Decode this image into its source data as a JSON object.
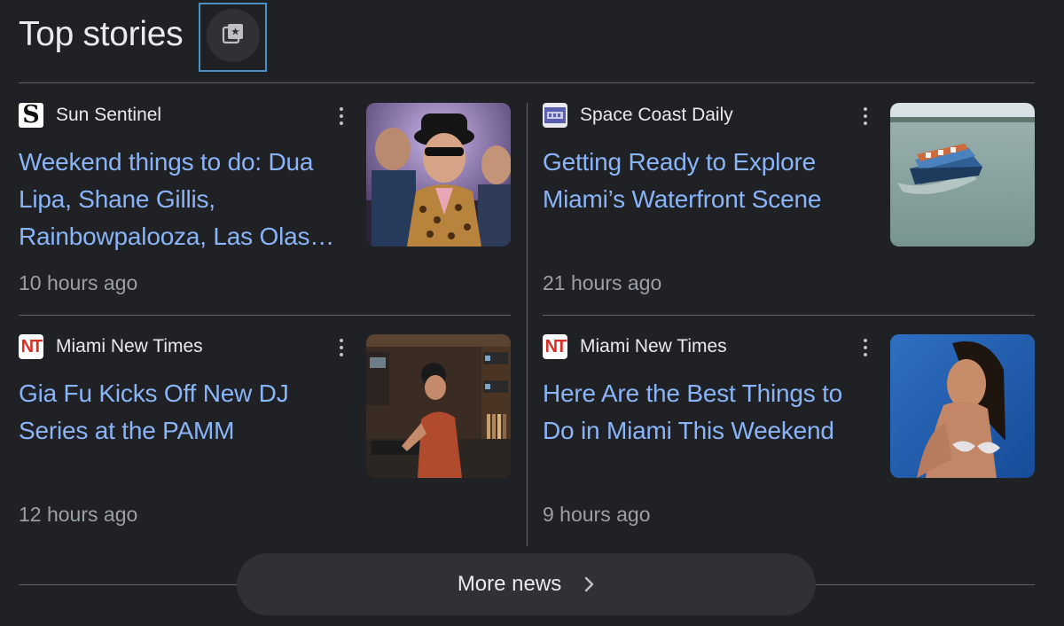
{
  "header": {
    "title": "Top stories",
    "action_icon": "stories-collection-icon"
  },
  "stories": [
    {
      "source": "Sun Sentinel",
      "source_logo_text": "S",
      "headline": "Weekend things to do: Dua Lipa, Shane Gillis, Rainbowpalooza, Las Olas…",
      "time": "10 hours ago",
      "thumbnail": "band-members-photo"
    },
    {
      "source": "Space Coast Daily",
      "source_logo_text": "",
      "headline": "Getting Ready to Explore Miami’s Waterfront Scene",
      "time": "21 hours ago",
      "thumbnail": "party-boat-on-bay-photo"
    },
    {
      "source": "Miami New Times",
      "source_logo_text": "NT",
      "headline": "Gia Fu Kicks Off New DJ Series at the PAMM",
      "time": "12 hours ago",
      "thumbnail": "dj-in-record-room-photo"
    },
    {
      "source": "Miami New Times",
      "source_logo_text": "NT",
      "headline": "Here Are the Best Things to Do in Miami This Weekend",
      "time": "9 hours ago",
      "thumbnail": "woman-portrait-blue-photo"
    }
  ],
  "more_button": {
    "label": "More news",
    "icon": "chevron-right-icon"
  },
  "colors": {
    "background": "#202124",
    "headline_link": "#8ab4f8",
    "secondary_text": "#9aa0a6",
    "divider": "#5f6368",
    "button_bg": "#303134"
  }
}
